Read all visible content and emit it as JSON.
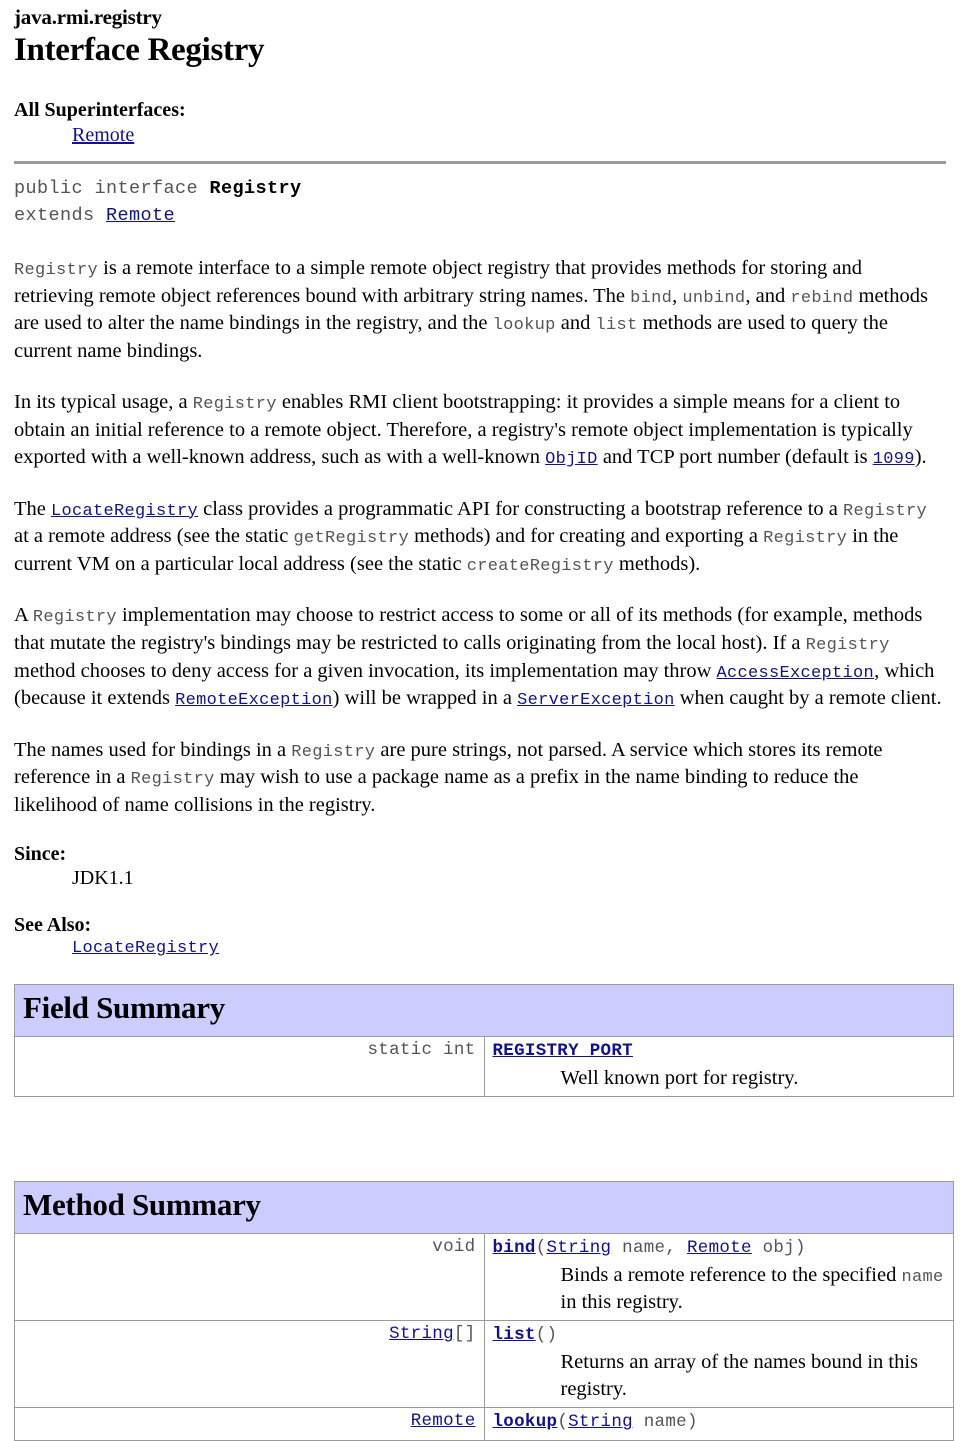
{
  "header": {
    "package": "java.rmi.registry",
    "title": "Interface Registry",
    "superinterfaces_label": "All Superinterfaces:",
    "superinterface_link": "Remote"
  },
  "declaration": {
    "modifiers": "public interface ",
    "name": "Registry",
    "extends_keyword": "extends ",
    "extends_link": "Remote"
  },
  "paragraphs": {
    "p1": {
      "s1": "Registry",
      "t1": " is a remote interface to a simple remote object registry that provides methods for storing and retrieving remote object references bound with arbitrary string names. The ",
      "s2": "bind",
      "t2": ", ",
      "s3": "unbind",
      "t3": ", and ",
      "s4": "rebind",
      "t4": " methods are used to alter the name bindings in the registry, and the ",
      "s5": "lookup",
      "t5": " and ",
      "s6": "list",
      "t6": " methods are used to query the current name bindings."
    },
    "p2": {
      "t1": "In its typical usage, a ",
      "s1": "Registry",
      "t2": " enables RMI client bootstrapping: it provides a simple means for a client to obtain an initial reference to a remote object. Therefore, a registry's remote object implementation is typically exported with a well-known address, such as with a well-known ",
      "l1": "ObjID",
      "t3": " and TCP port number (default is ",
      "l2": "1099",
      "t4": ")."
    },
    "p3": {
      "t1": "The ",
      "l1": "LocateRegistry",
      "t2": " class provides a programmatic API for constructing a bootstrap reference to a ",
      "s1": "Registry",
      "t3": " at a remote address (see the static ",
      "s2": "getRegistry",
      "t4": " methods) and for creating and exporting a ",
      "s3": "Registry",
      "t5": " in the current VM on a particular local address (see the static ",
      "s4": "createRegistry",
      "t6": " methods)."
    },
    "p4": {
      "t1": "A ",
      "s1": "Registry",
      "t2": " implementation may choose to restrict access to some or all of its methods (for example, methods that mutate the registry's bindings may be restricted to calls originating from the local host). If a ",
      "s2": "Registry",
      "t3": " method chooses to deny access for a given invocation, its implementation may throw ",
      "l1": "AccessException",
      "t4": ", which (because it extends ",
      "l2": "RemoteException",
      "t5": ") will be wrapped in a ",
      "l3": "ServerException",
      "t6": " when caught by a remote client."
    },
    "p5": {
      "t1": "The names used for bindings in a ",
      "s1": "Registry",
      "t2": " are pure strings, not parsed. A service which stores its remote reference in a ",
      "s2": "Registry",
      "t3": " may wish to use a package name as a prefix in the name binding to reduce the likelihood of name collisions in the registry."
    }
  },
  "since": {
    "label": "Since:",
    "value": "JDK1.1"
  },
  "see_also": {
    "label": "See Also:",
    "link": "LocateRegistry"
  },
  "field_summary": {
    "title": "Field Summary",
    "rows": [
      {
        "type": "static int",
        "name": "REGISTRY_PORT",
        "description": "Well known port for registry."
      }
    ]
  },
  "method_summary": {
    "title": "Method Summary",
    "rows": [
      {
        "type": "void",
        "type_is_link": false,
        "name": "bind",
        "sig_open": "(",
        "param_type_1": "String",
        "param_name_1": " name, ",
        "param_type_2": "Remote",
        "param_name_2": " obj",
        "sig_close": ")",
        "desc_pre": "Binds a remote reference to the specified ",
        "desc_code": "name",
        "desc_post": " in this registry."
      },
      {
        "type": "String[]",
        "type_is_link": true,
        "type_link_text": "String",
        "type_suffix": "[]",
        "name": "list",
        "sig_open": "(",
        "sig_close": ")",
        "desc_pre": "Returns an array of the names bound in this registry.",
        "desc_code": "",
        "desc_post": ""
      },
      {
        "type": "Remote",
        "type_is_link": true,
        "type_link_text": "Remote",
        "type_suffix": "",
        "name": "lookup",
        "sig_open": "(",
        "param_type_1": "String",
        "param_name_1": " name",
        "sig_close": ")"
      }
    ]
  },
  "colors": {
    "band": "#ccccff",
    "link": "#12128c",
    "code_gray": "#555555",
    "border": "#9a9a9a"
  }
}
